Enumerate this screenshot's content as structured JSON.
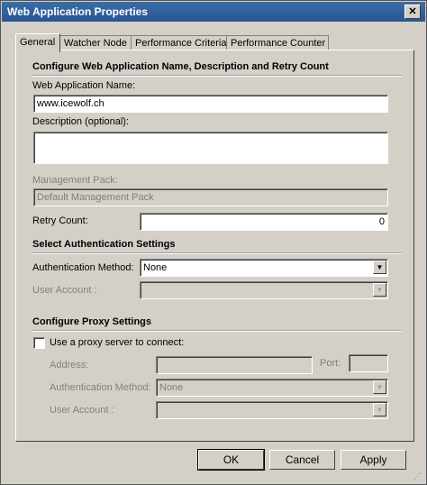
{
  "window": {
    "title": "Web Application Properties",
    "close_glyph": "✕"
  },
  "tabs": [
    {
      "label": "General"
    },
    {
      "label": "Watcher Node"
    },
    {
      "label": "Performance Criteria"
    },
    {
      "label": "Performance Counter"
    }
  ],
  "general": {
    "section_name": "Configure Web Application Name, Description and Retry Count",
    "name_label": "Web Application Name:",
    "name_value": "www.icewolf.ch",
    "description_label": "Description (optional):",
    "description_value": "",
    "mp_label": "Management Pack:",
    "mp_value": "Default Management Pack",
    "retry_label": "Retry Count:",
    "retry_value": "0"
  },
  "auth": {
    "section": "Select Authentication Settings",
    "method_label": "Authentication Method:",
    "method_value": "None",
    "account_label": "User Account :",
    "account_value": ""
  },
  "proxy": {
    "section": "Configure Proxy Settings",
    "use_proxy_label": "Use a proxy server to connect:",
    "use_proxy_checked": false,
    "address_label": "Address:",
    "address_value": "",
    "port_label": "Port:",
    "port_value": "",
    "method_label": "Authentication Method:",
    "method_value": "None",
    "account_label": "User Account :",
    "account_value": ""
  },
  "buttons": {
    "ok": "OK",
    "cancel": "Cancel",
    "apply": "Apply"
  }
}
